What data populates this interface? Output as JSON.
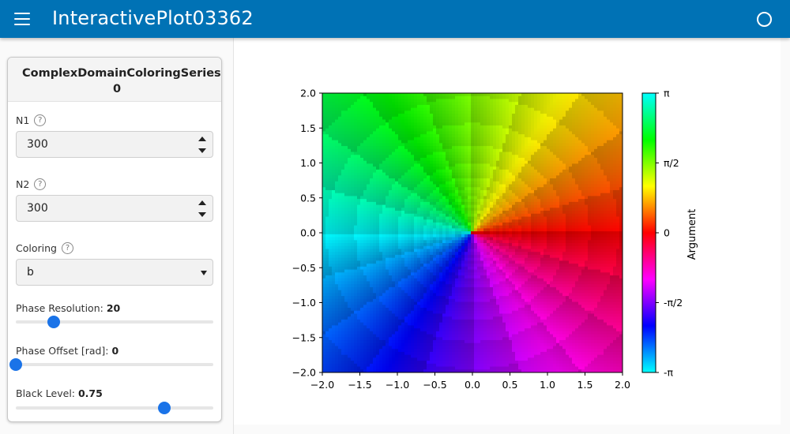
{
  "app": {
    "title": "InteractivePlot03362"
  },
  "panel": {
    "title": "ComplexDomainColoringSeries-0",
    "fields": {
      "n1": {
        "label": "N1",
        "value": "300"
      },
      "n2": {
        "label": "N2",
        "value": "300"
      },
      "coloring": {
        "label": "Coloring",
        "value": "b"
      }
    },
    "sliders": {
      "phase_resolution": {
        "label": "Phase Resolution:",
        "value": "20",
        "fraction": 0.19
      },
      "phase_offset": {
        "label": "Phase Offset [rad]:",
        "value": "0",
        "fraction": 0.0
      },
      "black_level": {
        "label": "Black Level:",
        "value": "0.75",
        "fraction": 0.75
      }
    }
  },
  "chart_data": {
    "type": "heatmap",
    "description_function": "complex domain coloring (argument-colored)",
    "xlim": [
      -2.0,
      2.0
    ],
    "ylim": [
      -2.0,
      2.0
    ],
    "xticks": [
      "−2.0",
      "−1.5",
      "−1.0",
      "−0.5",
      "0.0",
      "0.5",
      "1.0",
      "1.5",
      "2.0"
    ],
    "yticks": [
      "2.0",
      "1.5",
      "1.0",
      "0.5",
      "0.0",
      "−0.5",
      "−1.0",
      "−1.5",
      "−2.0"
    ],
    "colorbar": {
      "label": "Argument",
      "ticks": [
        "π",
        "π/2",
        "0",
        "-π/2",
        "-π"
      ]
    },
    "phase_resolution": 20,
    "black_level": 0.75
  },
  "icons": {
    "menu": "menu-icon",
    "status": "circle-status-icon",
    "help": "help-icon"
  },
  "colors": {
    "appbar": "#0072b5",
    "slider_accent": "#1a73e8"
  }
}
